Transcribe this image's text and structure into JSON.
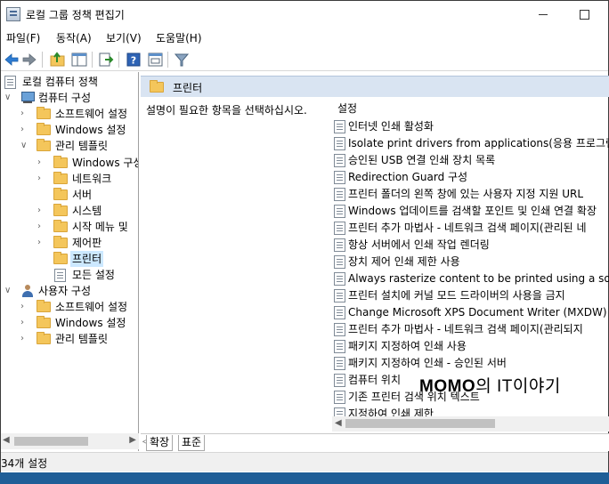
{
  "window": {
    "title": "로컬 그룹 정책 편집기"
  },
  "menu": [
    "파일(F)",
    "동작(A)",
    "보기(V)",
    "도움말(H)"
  ],
  "toolbar": {
    "icons": [
      "back-arrow-icon",
      "forward-arrow-icon",
      "up-folder-icon",
      "show-hide-tree-icon",
      "export-list-icon",
      "help-icon",
      "properties-icon",
      "filter-icon"
    ]
  },
  "tree": {
    "items": [
      {
        "label": "로컬 컴퓨터 정책",
        "icon": "doc"
      },
      {
        "label": "컴퓨터 구성",
        "icon": "computer",
        "chevron": "∨"
      },
      {
        "label": "소프트웨어 설정",
        "icon": "folder",
        "chevron": "›"
      },
      {
        "label": "Windows 설정",
        "icon": "folder",
        "chevron": "›"
      },
      {
        "label": "관리 템플릿",
        "icon": "folder",
        "chevron": "∨"
      },
      {
        "label": "Windows 구성",
        "icon": "folder",
        "chevron": "›"
      },
      {
        "label": "네트워크",
        "icon": "folder",
        "chevron": "›"
      },
      {
        "label": "서버",
        "icon": "folder"
      },
      {
        "label": "시스템",
        "icon": "folder",
        "chevron": "›"
      },
      {
        "label": "시작 메뉴 및",
        "icon": "folder",
        "chevron": "›"
      },
      {
        "label": "제어판",
        "icon": "folder",
        "chevron": "›"
      },
      {
        "label": "프린터",
        "icon": "folder",
        "selected": true
      },
      {
        "label": "모든 설정",
        "icon": "doc"
      },
      {
        "label": "사용자 구성",
        "icon": "user",
        "chevron": "∨"
      },
      {
        "label": "소프트웨어 설정",
        "icon": "folder",
        "chevron": "›"
      },
      {
        "label": "Windows 설정",
        "icon": "folder",
        "chevron": "›"
      },
      {
        "label": "관리 템플릿",
        "icon": "folder",
        "chevron": "›"
      }
    ]
  },
  "right": {
    "header": "프린터",
    "description": "설명이 필요한 항목을 선택하십시오.",
    "column": "설정",
    "items": [
      "인터넷 인쇄 활성화",
      "Isolate print drivers from applications(응용 프로그램에",
      "승인된 USB 연결 인쇄 장치 목록",
      "Redirection Guard 구성",
      "프린터 폴더의 왼쪽 창에 있는 사용자 지정 지원 URL",
      "Windows 업데이트를 검색할 포인트 및 인쇄 연결 확장",
      "프린터 추가 마법사 - 네트워크 검색 페이지(관리된 네",
      "항상 서버에서 인쇄 작업 렌더링",
      "장치 제어 인쇄 제한 사용",
      "Always rasterize content to be printed using a softwar",
      "프린터 설치에 커널 모드 드라이버의 사용을 금지",
      "Change Microsoft XPS Document Writer (MXDW) def",
      "프린터 추가 마법사 - 네트워크 검색 페이지(관리되지",
      "패키지 지정하여 인쇄 사용",
      "패키지 지정하여 인쇄 - 승인된 서버",
      "컴퓨터 위치",
      "기존 프린터 검색 위치 텍스트",
      "지정하여 인쇄 제한"
    ]
  },
  "tabs": [
    "확장",
    "표준"
  ],
  "status": "34개 설정",
  "watermark": {
    "brand": "MOMO",
    "text": "의 IT이야기"
  }
}
